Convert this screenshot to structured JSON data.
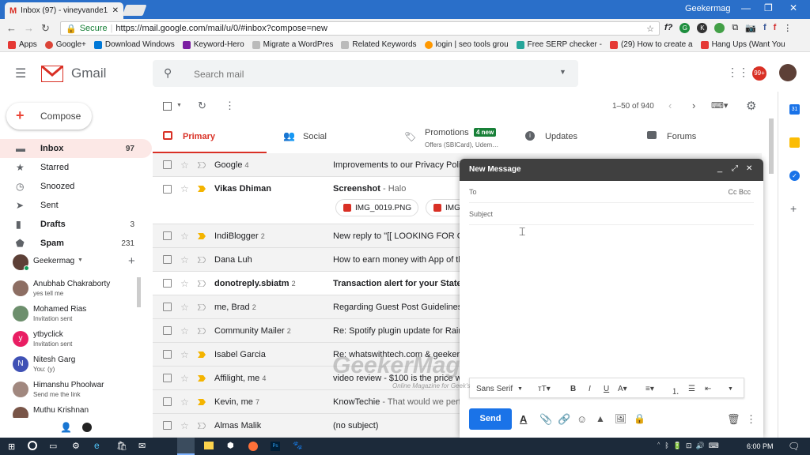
{
  "browser": {
    "tab_title": "Inbox (97) - vineyvande1…",
    "url_secure": "Secure",
    "url": "https://mail.google.com/mail/u/0/#inbox?compose=new",
    "profile": "Geekermag"
  },
  "bookmarks": [
    "Apps",
    "Google+",
    "Download Windows",
    "Keyword-Hero",
    "Migrate a WordPres",
    "Related Keywords",
    "login | seo tools grou",
    "Free SERP checker -",
    "(29) How to create a",
    "Hang Ups (Want You"
  ],
  "gmail": {
    "logo": "Gmail",
    "search_placeholder": "Search mail",
    "avatar_badge": "99+",
    "pagination": "1–50 of 940",
    "compose": "Compose"
  },
  "sidebar": [
    {
      "label": "Inbox",
      "count": "97",
      "icon": "inbox-icon"
    },
    {
      "label": "Starred",
      "count": "",
      "icon": "star-icon"
    },
    {
      "label": "Snoozed",
      "count": "",
      "icon": "clock-icon"
    },
    {
      "label": "Sent",
      "count": "",
      "icon": "send-icon"
    },
    {
      "label": "Drafts",
      "count": "3",
      "icon": "draft-icon"
    },
    {
      "label": "Spam",
      "count": "231",
      "icon": "spam-icon"
    }
  ],
  "hangouts": {
    "user": "Geekermag",
    "contacts": [
      {
        "name": "Anubhab Chakraborty",
        "status": "yes tell me",
        "initial": "",
        "color": "#8d6e63"
      },
      {
        "name": "Mohamed Rias",
        "status": "Invitation sent",
        "initial": "",
        "color": "#6d8f6d"
      },
      {
        "name": "ytbyclick",
        "status": "Invitation sent",
        "initial": "y",
        "color": "#e91e63"
      },
      {
        "name": "Nitesh Garg",
        "status": "You: (y)",
        "initial": "N",
        "color": "#3f51b5"
      },
      {
        "name": "Himanshu Phoolwar",
        "status": "Send me the link",
        "initial": "",
        "color": "#a1887f"
      },
      {
        "name": "Muthu Krishnan",
        "status": "",
        "initial": "",
        "color": "#795548"
      }
    ]
  },
  "tabs": [
    {
      "label": "Primary",
      "sub": ""
    },
    {
      "label": "Social",
      "sub": ""
    },
    {
      "label": "Promotions",
      "sub": "Offers (SBICard), Udem…",
      "badge": "4 new"
    },
    {
      "label": "Updates",
      "sub": ""
    },
    {
      "label": "Forums",
      "sub": ""
    }
  ],
  "emails": [
    {
      "sender": "Google",
      "count": "4",
      "subject": "Improvements to our Privacy Polic",
      "snippet": "",
      "unread": false,
      "imp": false
    },
    {
      "sender": "Vikas Dhiman",
      "count": "",
      "subject": "Screenshot",
      "snippet": " - Halo",
      "unread": true,
      "imp": true
    },
    {
      "sender": "IndiBlogger",
      "count": "2",
      "subject": "New reply to \"[[ LOOKING FOR GU",
      "snippet": "",
      "unread": false,
      "imp": true
    },
    {
      "sender": "Dana Luh",
      "count": "",
      "subject": "How to earn money with App of th",
      "snippet": "",
      "unread": false,
      "imp": false
    },
    {
      "sender": "donotreply.sbiatm",
      "count": "2",
      "subject": "Transaction alert for your State B",
      "snippet": "",
      "unread": true,
      "imp": false
    },
    {
      "sender": "me, Brad",
      "count": "2",
      "subject": "Regarding Guest Post Guidelines",
      "snippet": "",
      "unread": false,
      "imp": false
    },
    {
      "sender": "Community Mailer",
      "count": "2",
      "subject": "Re: Spotify plugin update for Rain",
      "snippet": "",
      "unread": false,
      "imp": false
    },
    {
      "sender": "Isabel Garcia",
      "count": "",
      "subject": "Re: whatswithtech.com & geekerm",
      "snippet": "",
      "unread": false,
      "imp": true
    },
    {
      "sender": "Affilight, me",
      "count": "4",
      "subject": "video review - $100 is the price w",
      "snippet": "",
      "unread": false,
      "imp": true
    },
    {
      "sender": "Kevin, me",
      "count": "7",
      "subject": "KnowTechie",
      "snippet": " - That would we perfo",
      "unread": false,
      "imp": true
    },
    {
      "sender": "Almas Malik",
      "count": "",
      "subject": "(no subject)",
      "snippet": "",
      "unread": false,
      "imp": false
    }
  ],
  "attachments": [
    "IMG_0019.PNG",
    "IMG"
  ],
  "compose": {
    "title": "New Message",
    "to": "To",
    "cc_bcc": "Cc Bcc",
    "subject": "Subject",
    "font": "Sans Serif",
    "send": "Send"
  },
  "watermark": {
    "title": "GeekerMag",
    "tagline": "Online Magazine for Geek's"
  },
  "taskbar": {
    "time": "6:00 PM"
  }
}
